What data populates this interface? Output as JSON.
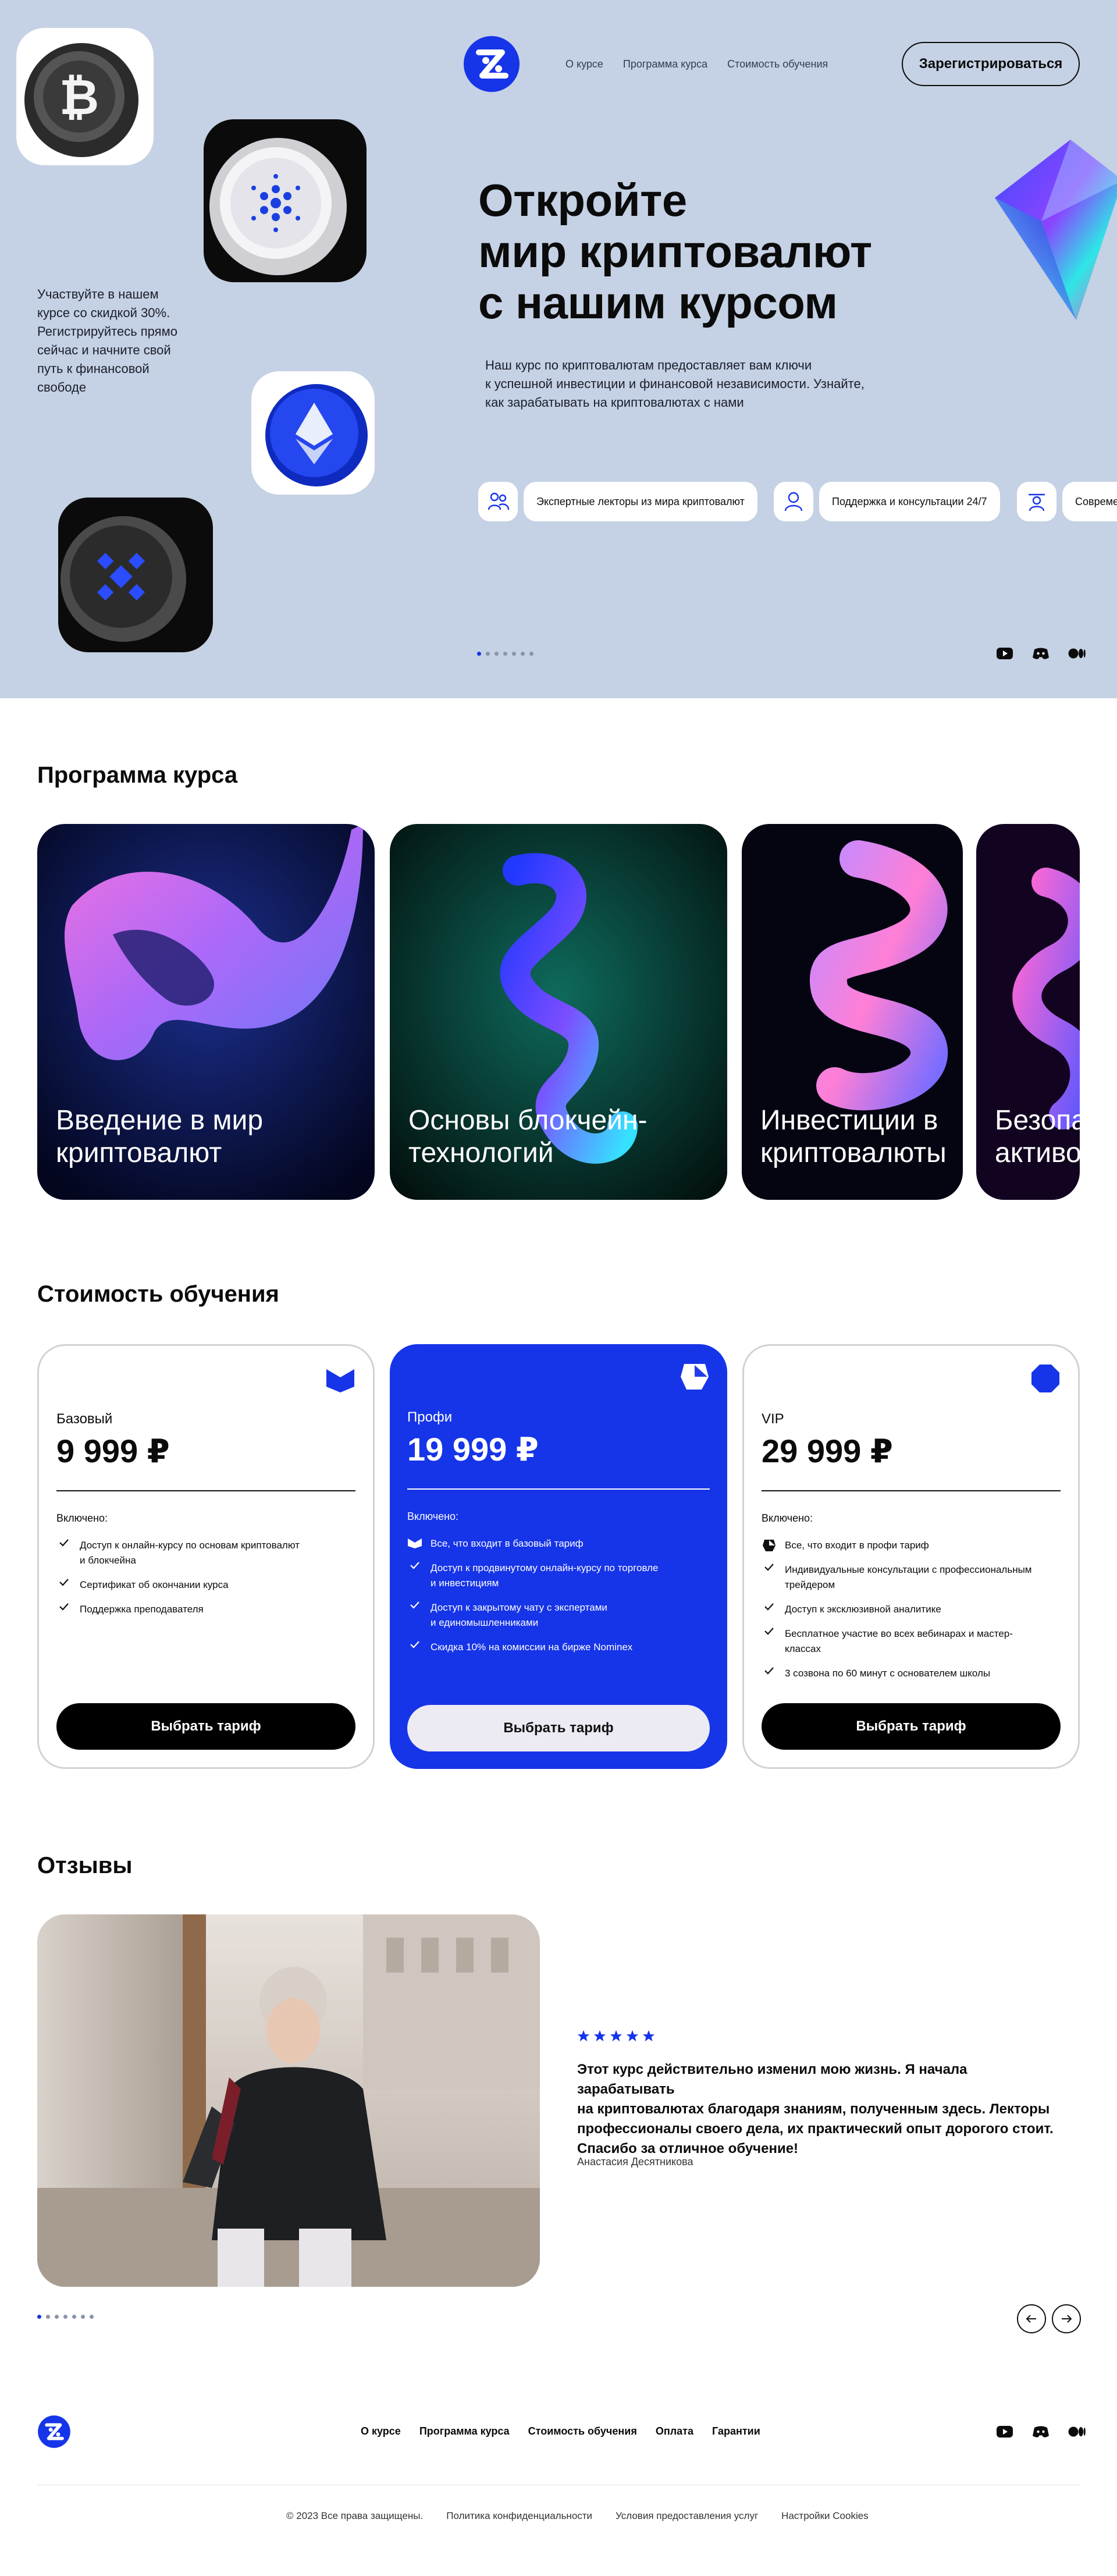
{
  "colors": {
    "hero_bg": "#c5d1e4",
    "accent": "#1634e8",
    "black": "#0b0b0b",
    "light_button": "#eceaf3"
  },
  "header": {
    "nav": [
      "О курсе",
      "Программа курса",
      "Стоимость обучения"
    ],
    "register_label": "Зарегистрироваться"
  },
  "hero": {
    "title_lines": [
      "Откройте",
      "мир криптовалют",
      "с нашим курсом"
    ],
    "subtitle_lines": [
      "Наш курс по криптовалютам предоставляет вам ключи",
      "к успешной инвестиции и финансовой независимости. Узнайте,",
      "как зарабатывать на криптовалютах с нами"
    ],
    "discount_lines": [
      "Участвуйте в нашем",
      "курсе со скидкой 30%.",
      "Регистрируйтесь прямо",
      "сейчас и начните свой",
      "путь к финансовой",
      "свободе"
    ],
    "features": [
      {
        "icon": "people-icon",
        "label": "Экспертные лекторы из мира криптовалют"
      },
      {
        "icon": "support-icon",
        "label": "Поддержка и консультации 24/7"
      },
      {
        "icon": "teacher-icon",
        "label": "Совреме"
      }
    ],
    "coins": [
      "bitcoin-coin",
      "cardano-coin",
      "ethereum-coin",
      "bnb-coin"
    ],
    "slider_count": 7,
    "slider_active": 0
  },
  "social": [
    "youtube-icon",
    "discord-icon",
    "medium-icon"
  ],
  "program": {
    "title": "Программа курса",
    "cards": [
      {
        "title_lines": [
          "Введение в мир",
          "криптовалют"
        ]
      },
      {
        "title_lines": [
          "Основы блокчейн-",
          "технологий"
        ]
      },
      {
        "title_lines": [
          "Инвестиции в",
          "криптовалюты"
        ]
      },
      {
        "title_lines": [
          "Безопа",
          "активо"
        ]
      }
    ]
  },
  "pricing": {
    "title": "Стоимость обучения",
    "included_label": "Включено:",
    "plans": [
      {
        "name": "Базовый",
        "price": "9 999 ₽",
        "button": "Выбрать тариф",
        "items": [
          [
            "Доступ к онлайн-курсу по основам криптовалют",
            "и блокчейна"
          ],
          [
            "Сертификат об окончании курса"
          ],
          [
            "Поддержка преподавателя"
          ]
        ]
      },
      {
        "name": "Профи",
        "price": "19 999 ₽",
        "button": "Выбрать тариф",
        "items": [
          [
            "Все, что входит в базовый тариф"
          ],
          [
            "Доступ к продвинутому онлайн-курсу по торговле",
            "и инвестициям"
          ],
          [
            "Доступ к закрытому чату с экспертами",
            "и единомышленниками"
          ],
          [
            "Скидка 10% на комиссии на бирже Nominex"
          ]
        ]
      },
      {
        "name": "VIP",
        "price": "29 999 ₽",
        "button": "Выбрать тариф",
        "items": [
          [
            "Все, что входит в профи тариф"
          ],
          [
            "Индивидуальные консультации с профессиональным",
            "трейдером"
          ],
          [
            "Доступ к эксклюзивной аналитике"
          ],
          [
            "Бесплатное участие во всех вебинарах и мастер-",
            "классах"
          ],
          [
            "3 созвона по 60 минут с основателем школы"
          ]
        ]
      }
    ]
  },
  "reviews": {
    "title": "Отзывы",
    "rating": 5,
    "text_lines": [
      "Этот курс действительно изменил мою жизнь. Я начала зарабатывать",
      "на криптовалютах благодаря знаниям, полученным здесь. Лекторы",
      "профессионалы своего дела, их практический опыт дорогого стоит.",
      "Спасибо за отличное обучение!"
    ],
    "author": "Анастасия Десятникова",
    "slider_count": 7,
    "slider_active": 0
  },
  "footer": {
    "nav": [
      "О курсе",
      "Программа курса",
      "Стоимость обучения",
      "Оплата",
      "Гарантии"
    ],
    "legal": [
      "© 2023 Все права защищены.",
      "Политика конфиденциальности",
      "Условия предоставления услуг",
      "Настройки Cookies"
    ]
  }
}
